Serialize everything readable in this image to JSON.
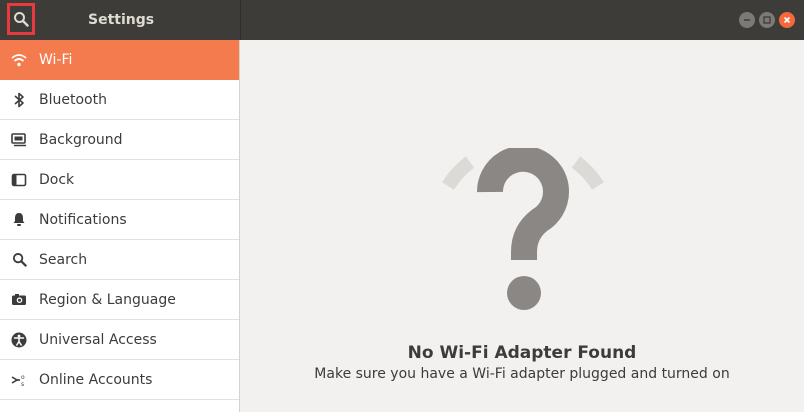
{
  "header": {
    "title": "Settings",
    "search_icon": "search-icon",
    "window_buttons": [
      "minimize-icon",
      "maximize-icon",
      "close-icon"
    ]
  },
  "sidebar": {
    "items": [
      {
        "label": "Wi-Fi",
        "icon": "wifi-icon",
        "active": true
      },
      {
        "label": "Bluetooth",
        "icon": "bluetooth-icon"
      },
      {
        "label": "Background",
        "icon": "background-icon"
      },
      {
        "label": "Dock",
        "icon": "dock-icon"
      },
      {
        "label": "Notifications",
        "icon": "bell-icon"
      },
      {
        "label": "Search",
        "icon": "search-icon"
      },
      {
        "label": "Region & Language",
        "icon": "camera-icon"
      },
      {
        "label": "Universal Access",
        "icon": "accessibility-icon"
      },
      {
        "label": "Online Accounts",
        "icon": "online-accounts-icon"
      }
    ]
  },
  "main": {
    "empty_title": "No Wi-Fi Adapter Found",
    "empty_subtitle": "Make sure you have a Wi-Fi adapter plugged and turned on"
  },
  "colors": {
    "accent": "#f47b4d",
    "titlebar": "#3d3c39",
    "highlight_border": "#e8393f"
  }
}
